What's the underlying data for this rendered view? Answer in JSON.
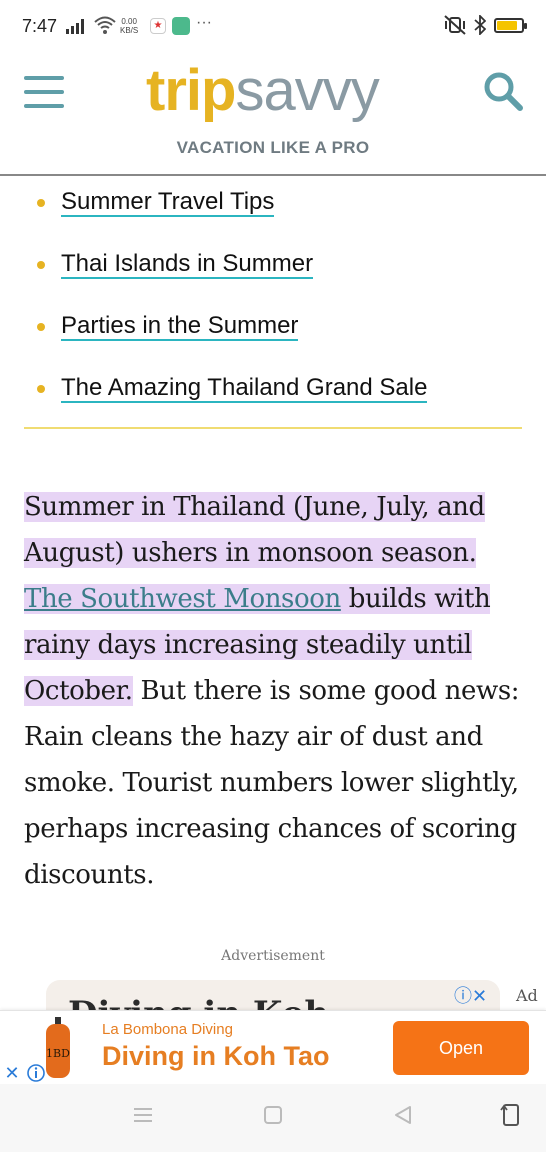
{
  "status_bar": {
    "time": "7:47",
    "net_speed_value": "0.00",
    "net_speed_unit": "KB/S",
    "more": "···"
  },
  "header": {
    "logo_trip": "trip",
    "logo_savvy": "savvy",
    "tagline": "VACATION LIKE A PRO"
  },
  "related_links": [
    {
      "label": "Summer Travel Tips"
    },
    {
      "label": "Thai Islands in Summer"
    },
    {
      "label": "Parties in the Summer"
    },
    {
      "label": "The Amazing Thailand Grand Sale"
    }
  ],
  "article": {
    "p1_part1": "Summer in Thailand (June, July, and August) ushers in monsoon season.",
    "p1_link": "The Southwest Monsoon",
    "p1_part2": " builds with rainy days increasing steadily until October.",
    "p1_part3": " But there is some good news: Rain cleans the hazy air of dust and smoke. Tourist numbers lower slightly, perhaps increasing chances of scoring discounts."
  },
  "advertisement": {
    "label": "Advertisement",
    "ghost_text": "Diving in Koh",
    "ad_badge": "Ad"
  },
  "banner": {
    "advertiser": "La Bombona Diving",
    "headline": "Diving in Koh Tao",
    "cta": "Open"
  },
  "colors": {
    "brand_yellow": "#e6b322",
    "brand_teal": "#5f9ea8",
    "highlight": "#e7d4f5",
    "link_underline": "#2bb5c0",
    "cta_orange": "#f57316"
  }
}
